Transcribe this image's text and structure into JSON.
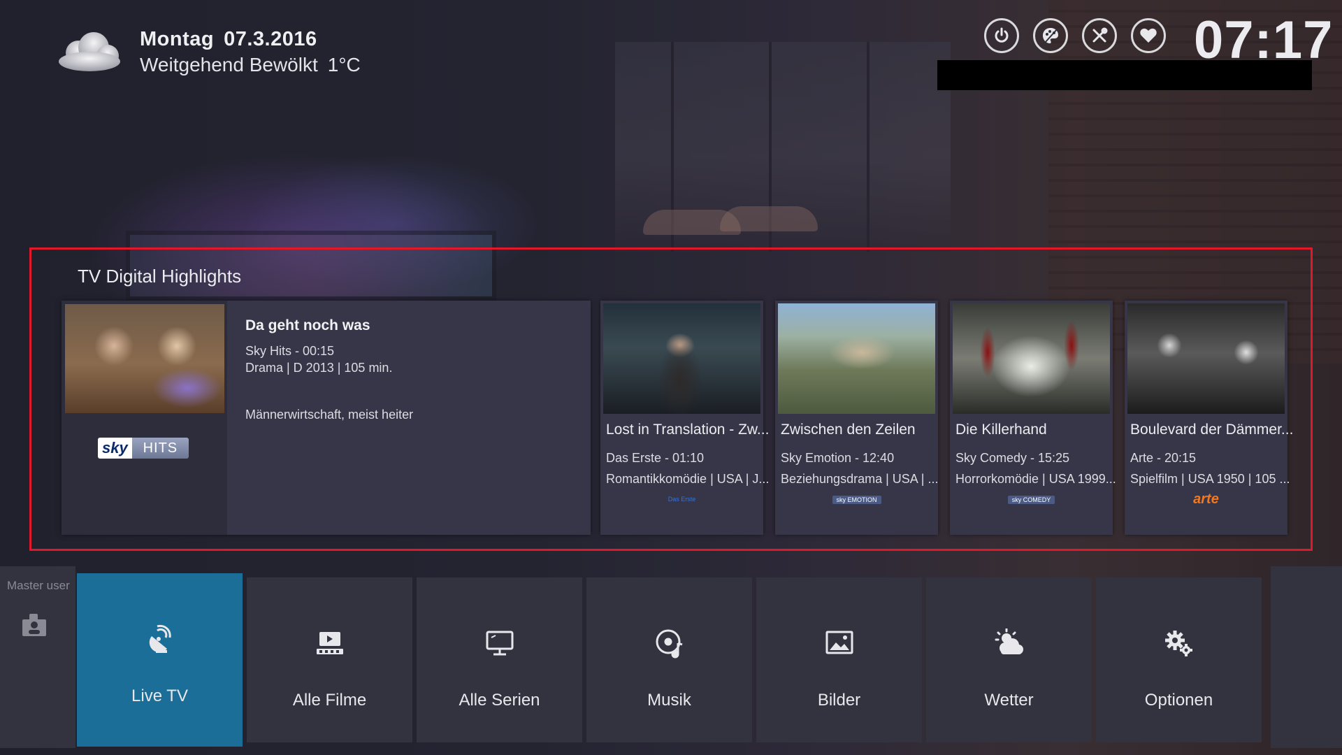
{
  "header": {
    "weather": {
      "day": "Montag",
      "date": "07.3.2016",
      "condition": "Weitgehend Bewölkt",
      "temperature": "1°C",
      "icon": "cloud-icon"
    },
    "top_icons": [
      "power-icon",
      "palette-icon",
      "tools-icon",
      "heart-icon"
    ],
    "clock": "07:17"
  },
  "highlights": {
    "title": "TV Digital Highlights",
    "featured": {
      "title": "Da geht noch was",
      "channel_time": "Sky Hits - 00:15",
      "genre_info": "Drama | D 2013 | 105 min.",
      "description": "Männerwirtschaft, meist heiter",
      "logo": {
        "part1": "sky",
        "part2": "HITS"
      }
    },
    "cards": [
      {
        "title": "Lost in Translation - Zw...",
        "channel_time": "Das Erste - 01:10",
        "genre_info": "Romantikkomödie | USA | J...",
        "logo": "Das Erste"
      },
      {
        "title": "Zwischen den Zeilen",
        "channel_time": "Sky Emotion - 12:40",
        "genre_info": "Beziehungsdrama | USA | ...",
        "logo": "sky EMOTION"
      },
      {
        "title": "Die Killerhand",
        "channel_time": "Sky Comedy - 15:25",
        "genre_info": "Horrorkomödie | USA 1999...",
        "logo": "sky COMEDY"
      },
      {
        "title": "Boulevard der Dämmer...",
        "channel_time": "Arte - 20:15",
        "genre_info": "Spielfilm | USA 1950 | 105 ...",
        "logo": "arte"
      }
    ],
    "accent_color": "#e0182a"
  },
  "sidebar": {
    "user_label": "Master user",
    "user_icon": "user-icon"
  },
  "nav": {
    "active_color": "#1a6e97",
    "items": [
      {
        "label": "Live TV",
        "icon": "satellite-icon",
        "active": true
      },
      {
        "label": "Alle Filme",
        "icon": "film-icon",
        "active": false
      },
      {
        "label": "Alle Serien",
        "icon": "monitor-icon",
        "active": false
      },
      {
        "label": "Musik",
        "icon": "music-icon",
        "active": false
      },
      {
        "label": "Bilder",
        "icon": "image-icon",
        "active": false
      },
      {
        "label": "Wetter",
        "icon": "weather-icon",
        "active": false
      },
      {
        "label": "Optionen",
        "icon": "gears-icon",
        "active": false
      }
    ]
  }
}
